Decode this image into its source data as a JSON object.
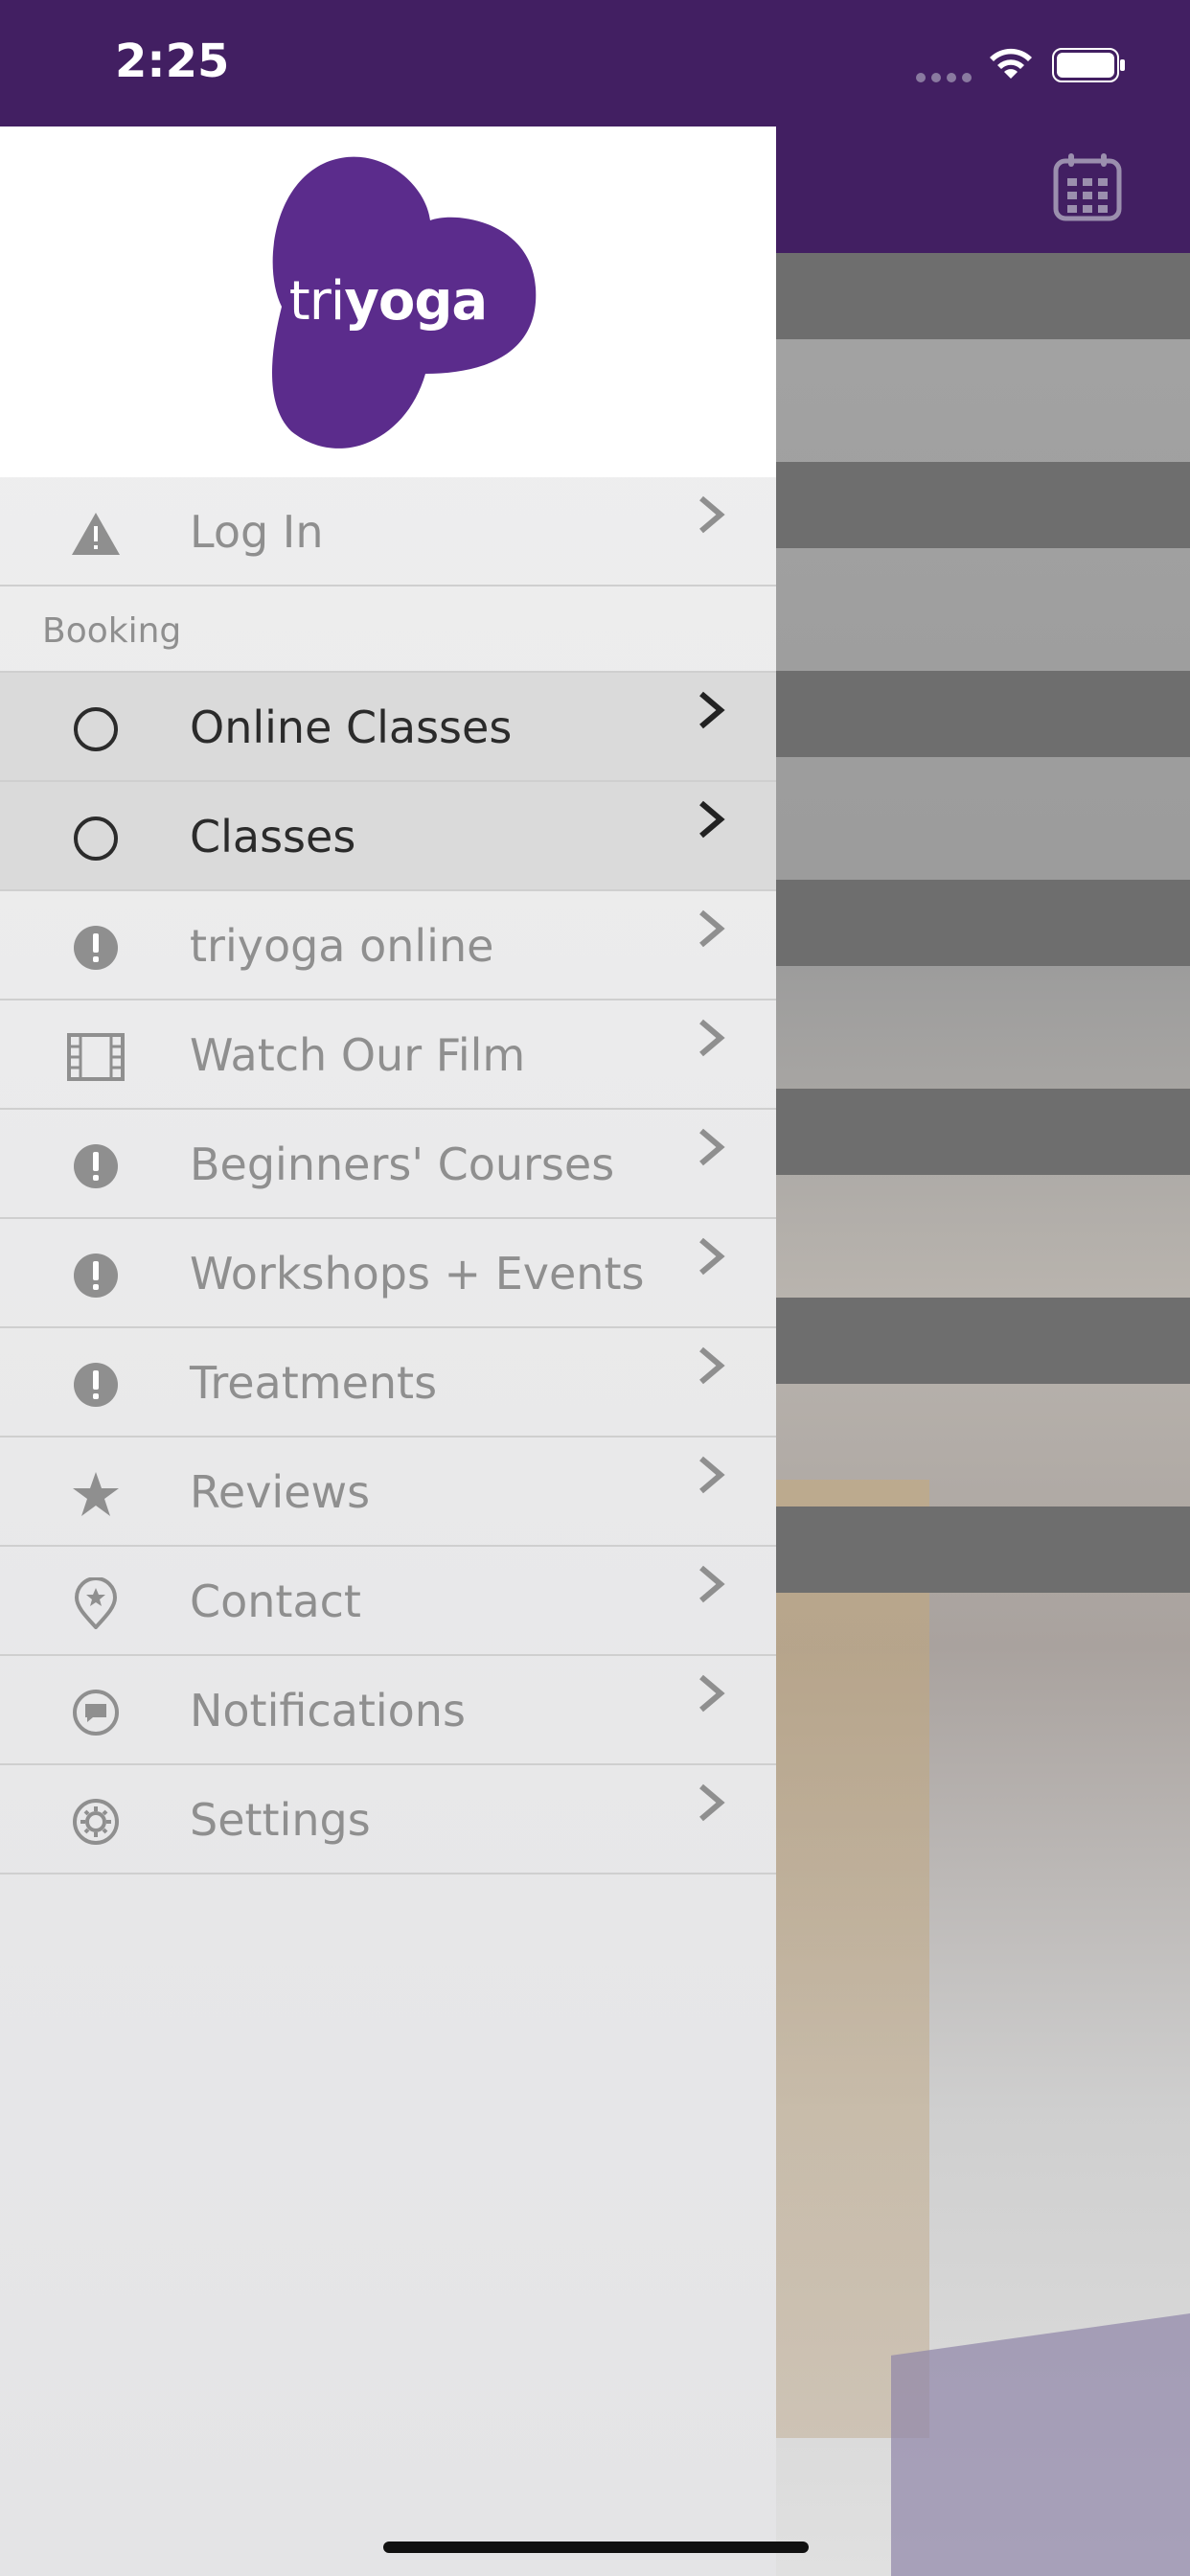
{
  "status_bar": {
    "time": "2:25"
  },
  "brand": {
    "logo_text_light": "tri",
    "logo_text_bold": "yoga",
    "color": "#5a2a8a"
  },
  "menu": {
    "login": {
      "label": "Log In",
      "icon": "warning-icon"
    },
    "section_booking": "Booking",
    "items": [
      {
        "label": "Online Classes",
        "icon": "circle-icon",
        "active": true
      },
      {
        "label": "Classes",
        "icon": "circle-icon",
        "active": true
      },
      {
        "label": "triyoga online",
        "icon": "exclamation-icon"
      },
      {
        "label": "Watch Our Film",
        "icon": "film-icon"
      },
      {
        "label": "Beginners' Courses",
        "icon": "exclamation-icon"
      },
      {
        "label": "Workshops + Events",
        "icon": "exclamation-icon"
      },
      {
        "label": "Treatments",
        "icon": "exclamation-icon"
      },
      {
        "label": "Reviews",
        "icon": "star-icon"
      },
      {
        "label": "Contact",
        "icon": "location-pin-icon"
      },
      {
        "label": "Notifications",
        "icon": "chat-bubble-icon"
      },
      {
        "label": "Settings",
        "icon": "gear-icon"
      }
    ]
  }
}
